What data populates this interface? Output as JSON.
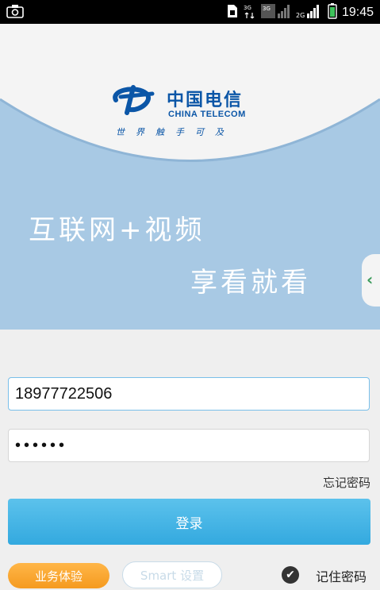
{
  "status_bar": {
    "time": "19:45",
    "left_icon": "screenshot-icon",
    "icons": [
      "sim-icon",
      "3g-icon",
      "3g-signal-icon",
      "2g-signal-icon",
      "battery-icon"
    ],
    "network_labels": [
      "3G",
      "3G",
      "2G"
    ]
  },
  "brand": {
    "name_cn": "中国电信",
    "name_en": "CHINA TELECOM",
    "slogan": "世界触手可及",
    "logo_icon": "china-telecom-logo-icon",
    "color": "#0b56a7"
  },
  "banner": {
    "line1": "互联网+视频",
    "line2": "享看就看",
    "background_color": "#a8c9e4"
  },
  "side_tab": {
    "icon": "chevron-left-icon",
    "glyph": "‹"
  },
  "login_form": {
    "username_value": "18977722506",
    "password_value": "••••••",
    "forgot_password": "忘记密码",
    "login_button": "登录",
    "accent_color": "#33a9df"
  },
  "bottom": {
    "biz_experience_button": "业务体验",
    "smart_settings_button": "Smart 设置",
    "remember_icon": "check-circle-icon",
    "remember_glyph": "✔",
    "remember_label": "记住密码"
  }
}
